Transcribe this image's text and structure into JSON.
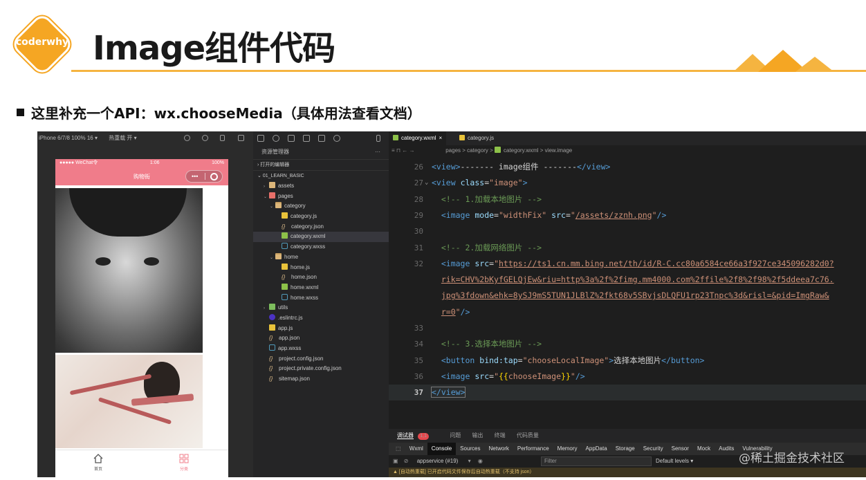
{
  "slide": {
    "logo_text": "coderwhy",
    "title": "Image组件代码",
    "bullet": "这里补充一个API：wx.chooseMedia（具体用法查看文档）",
    "accent": "#f5a623"
  },
  "simulator": {
    "toolbar": {
      "device": "iPhone 6/7/8 100% 16 ▾",
      "hotreload": "热重载 开 ▾"
    },
    "status": {
      "carrier": "●●●●● WeChat令",
      "time": "1:06",
      "battery": "100%"
    },
    "nav_title": "购物街",
    "capsule_dots": "•••",
    "tabs": [
      {
        "label": "首页"
      },
      {
        "label": "分类"
      }
    ],
    "nav_color": "#f07c8a"
  },
  "explorer": {
    "title": "资源管理器",
    "more": "···",
    "sections": {
      "open_editors": "打开的编辑器",
      "project": "01_LEARN_BASIC"
    },
    "tree": [
      {
        "name": "assets",
        "tw": "›",
        "icon": "folder"
      },
      {
        "name": "pages",
        "tw": "⌄",
        "icon": "pages"
      },
      {
        "name": "category",
        "tw": "⌄",
        "icon": "folder-open"
      },
      {
        "name": "category.js",
        "tw": "",
        "icon": "js"
      },
      {
        "name": "category.json",
        "tw": "",
        "icon": "json"
      },
      {
        "name": "category.wxml",
        "tw": "",
        "icon": "wxml",
        "selected": true
      },
      {
        "name": "category.wxss",
        "tw": "",
        "icon": "wxss"
      },
      {
        "name": "home",
        "tw": "⌄",
        "icon": "folder-open"
      },
      {
        "name": "home.js",
        "tw": "",
        "icon": "js"
      },
      {
        "name": "home.json",
        "tw": "",
        "icon": "json"
      },
      {
        "name": "home.wxml",
        "tw": "",
        "icon": "wxml"
      },
      {
        "name": "home.wxss",
        "tw": "",
        "icon": "wxss"
      },
      {
        "name": "utils",
        "tw": "›",
        "icon": "utils"
      },
      {
        "name": ".eslintrc.js",
        "tw": "",
        "icon": "eslint"
      },
      {
        "name": "app.js",
        "tw": "",
        "icon": "js"
      },
      {
        "name": "app.json",
        "tw": "",
        "icon": "json"
      },
      {
        "name": "app.wxss",
        "tw": "",
        "icon": "wxss"
      },
      {
        "name": "project.config.json",
        "tw": "",
        "icon": "json"
      },
      {
        "name": "project.private.config.json",
        "tw": "",
        "icon": "json"
      },
      {
        "name": "sitemap.json",
        "tw": "",
        "icon": "json"
      }
    ]
  },
  "editor": {
    "tabs": [
      {
        "label": "category.wxml",
        "close": "×"
      },
      {
        "label": "category.js"
      }
    ],
    "breadcrumb": {
      "pages": "pages",
      "category": "category",
      "file": "category.wxml",
      "node": "view.image",
      "sep": ">"
    },
    "lines": [
      {
        "no": "26",
        "fold": "",
        "html": "<span class=\"t-tag\">&lt;view&gt;</span>------- image组件 -------<span class=\"t-tag\">&lt;/view&gt;</span>"
      },
      {
        "no": "27",
        "fold": "⌄",
        "html": "<span class=\"t-tag\">&lt;view</span> <span class=\"t-attr\">class</span>=<span class=\"t-str\">\"image\"</span><span class=\"t-tag\">&gt;</span>"
      },
      {
        "no": "28",
        "fold": "",
        "html": "  <span class=\"t-com\">&lt;!-- 1.加载本地图片 --&gt;</span>"
      },
      {
        "no": "29",
        "fold": "",
        "html": "  <span class=\"t-tag\">&lt;image</span> <span class=\"t-attr\">mode</span>=<span class=\"t-str\">\"widthFix\"</span> <span class=\"t-attr\">src</span>=<span class=\"t-str\">\"<span class=\"t-und\">/assets/zznh.png</span>\"</span><span class=\"t-tag\">/&gt;</span>"
      },
      {
        "no": "30",
        "fold": "",
        "html": ""
      },
      {
        "no": "31",
        "fold": "",
        "html": "  <span class=\"t-com\">&lt;!-- 2.加载网络图片 --&gt;</span>"
      },
      {
        "no": "32",
        "fold": "",
        "html": "  <span class=\"t-tag\">&lt;image</span> <span class=\"t-attr\">src</span>=<span class=\"t-str\">\"<span class=\"t-und\">https://ts1.cn.mm.bing.net/th/id/R-C.cc80a6584ce66a3f927ce345096282d0?</span></span>"
      },
      {
        "no": "",
        "fold": "",
        "html": "  <span class=\"t-str t-und\">rik=CHV%2bKyfGELQjEw&amp;riu=http%3a%2f%2fimg.mm4000.com%2ffile%2f8%2f98%2f5ddeea7c76.</span>"
      },
      {
        "no": "",
        "fold": "",
        "html": "  <span class=\"t-str t-und\">jpg%3fdown&amp;ehk=8ySJ9mS5TUN1JLBlZ%2fkt68v5SBvjsDLQFU1rp23Tnpc%3d&amp;risl=&amp;pid=ImgRaw&amp;</span>"
      },
      {
        "no": "",
        "fold": "",
        "html": "  <span class=\"t-str\"><span class=\"t-und\">r=0</span>\"</span><span class=\"t-tag\">/&gt;</span>"
      },
      {
        "no": "33",
        "fold": "",
        "html": ""
      },
      {
        "no": "34",
        "fold": "",
        "html": "  <span class=\"t-com\">&lt;!-- 3.选择本地图片 --&gt;</span>"
      },
      {
        "no": "35",
        "fold": "",
        "html": "  <span class=\"t-tag\">&lt;button</span> <span class=\"t-attr\">bind:tap</span>=<span class=\"t-str\">\"chooseLocalImage\"</span><span class=\"t-tag\">&gt;</span>选择本地图片<span class=\"t-tag\">&lt;/button&gt;</span>"
      },
      {
        "no": "36",
        "fold": "",
        "html": "  <span class=\"t-tag\">&lt;image</span> <span class=\"t-attr\">src</span>=<span class=\"t-str\">\"<span class=\"t-brace\">{{</span>chooseImage<span class=\"t-brace\">}}</span>\"</span><span class=\"t-tag\">/&gt;</span>"
      },
      {
        "no": "37",
        "fold": "",
        "current": true,
        "html": "<span class=\"t-tag sel-box\">&lt;/view&gt;</span>"
      }
    ]
  },
  "devtools": {
    "top": {
      "debugger": "调试器",
      "badge": "1,1",
      "problems": "问题",
      "output": "输出",
      "terminal": "终端",
      "quality": "代码质量"
    },
    "tabs": [
      "Wxml",
      "Console",
      "Sources",
      "Network",
      "Performance",
      "Memory",
      "AppData",
      "Storage",
      "Security",
      "Sensor",
      "Mock",
      "Audits",
      "Vulnerability"
    ],
    "active_tab": "Console",
    "context": "appservice (#19)",
    "filter_placeholder": "Filter",
    "levels": "Default levels ▾",
    "warning": "▲ [自动热重载] 已开启代码文件保存后自动热重载（不支持 json）"
  },
  "watermark": "@稀土掘金技术社区"
}
